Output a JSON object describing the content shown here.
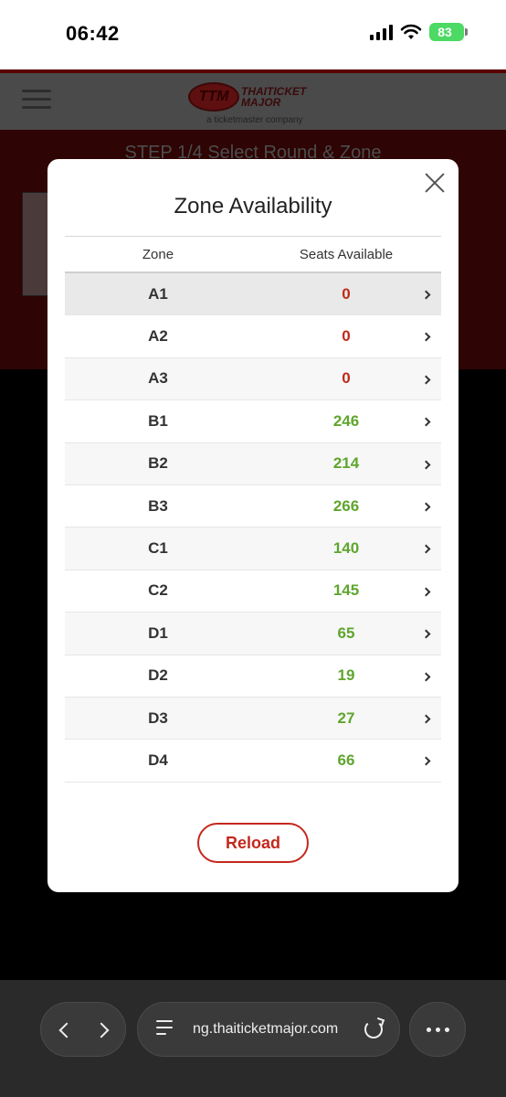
{
  "status_bar": {
    "time": "06:42",
    "battery": "83",
    "icons": [
      "cellular-signal-icon",
      "wifi-icon",
      "battery-charging-icon"
    ]
  },
  "site": {
    "logo_badge": "TTM",
    "logo_name_line1": "THAITICKET",
    "logo_name_line2": "MAJOR",
    "logo_sub": "a ticketmaster company",
    "step_title": "STEP 1/4 Select Round & Zone"
  },
  "modal": {
    "title": "Zone Availability",
    "columns": [
      "Zone",
      "Seats Available"
    ],
    "rows": [
      {
        "zone": "A1",
        "seats": "0"
      },
      {
        "zone": "A2",
        "seats": "0"
      },
      {
        "zone": "A3",
        "seats": "0"
      },
      {
        "zone": "B1",
        "seats": "246"
      },
      {
        "zone": "B2",
        "seats": "214"
      },
      {
        "zone": "B3",
        "seats": "266"
      },
      {
        "zone": "C1",
        "seats": "140"
      },
      {
        "zone": "C2",
        "seats": "145"
      },
      {
        "zone": "D1",
        "seats": "65"
      },
      {
        "zone": "D2",
        "seats": "19"
      },
      {
        "zone": "D3",
        "seats": "27"
      },
      {
        "zone": "D4",
        "seats": "66"
      }
    ],
    "reload_label": "Reload"
  },
  "browser": {
    "url": "ng.thaiticketmajor.com"
  },
  "colors": {
    "soldout": "#c02a1a",
    "available": "#5fa52e",
    "brand": "#c4281c"
  }
}
